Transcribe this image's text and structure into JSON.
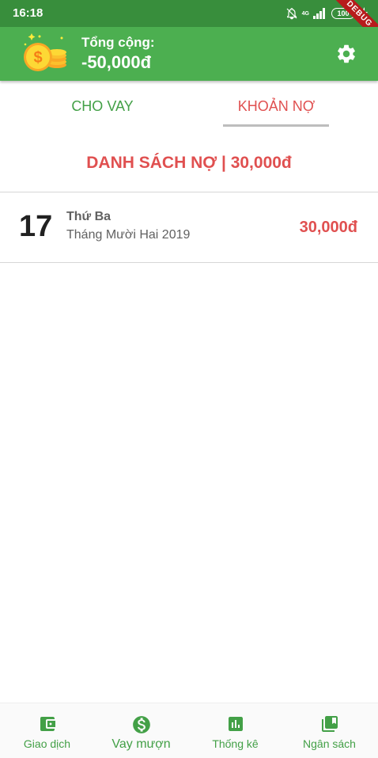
{
  "status_bar": {
    "time": "16:18",
    "network": "4G",
    "battery": "100"
  },
  "debug_banner": "DEBUG",
  "header": {
    "total_label": "Tổng cộng:",
    "total_value": "-50,000đ",
    "logo_icon": "coins-icon",
    "settings_icon": "gear-icon"
  },
  "tabs": [
    {
      "label": "CHO VAY",
      "selected": false
    },
    {
      "label": "KHOẢN NỢ",
      "selected": true
    }
  ],
  "section": {
    "title": "DANH SÁCH NỢ | 30,000đ"
  },
  "debts": [
    {
      "day": "17",
      "weekday": "Thứ Ba",
      "month_year": "Tháng Mười Hai 2019",
      "amount": "30,000đ"
    }
  ],
  "bottom_nav": [
    {
      "label": "Giao dịch",
      "icon": "wallet-icon",
      "active": false
    },
    {
      "label": "Vay mượn",
      "icon": "dollar-circle-icon",
      "active": true
    },
    {
      "label": "Thống kê",
      "icon": "bar-chart-icon",
      "active": false
    },
    {
      "label": "Ngân sách",
      "icon": "library-icon",
      "active": false
    }
  ],
  "colors": {
    "primary": "#4caf50",
    "primary_dark": "#388e3c",
    "accent_red": "#e05050",
    "tab_green": "#43a047"
  }
}
